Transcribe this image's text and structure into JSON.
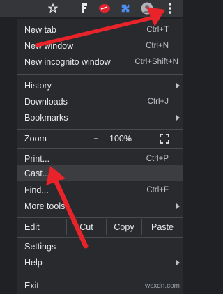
{
  "menu": {
    "new_tab": {
      "label": "New tab",
      "shortcut": "Ctrl+T"
    },
    "new_window": {
      "label": "New window",
      "shortcut": "Ctrl+N"
    },
    "new_incognito": {
      "label": "New incognito window",
      "shortcut": "Ctrl+Shift+N"
    },
    "history": {
      "label": "History"
    },
    "downloads": {
      "label": "Downloads",
      "shortcut": "Ctrl+J"
    },
    "bookmarks": {
      "label": "Bookmarks"
    },
    "zoom": {
      "label": "Zoom",
      "minus": "−",
      "value": "100%",
      "plus": "+"
    },
    "print": {
      "label": "Print...",
      "shortcut": "Ctrl+P"
    },
    "cast": {
      "label": "Cast..."
    },
    "find": {
      "label": "Find...",
      "shortcut": "Ctrl+F"
    },
    "more_tools": {
      "label": "More tools"
    },
    "edit": {
      "label": "Edit",
      "cut": "Cut",
      "copy": "Copy",
      "paste": "Paste"
    },
    "settings": {
      "label": "Settings"
    },
    "help": {
      "label": "Help"
    },
    "exit": {
      "label": "Exit"
    }
  },
  "watermark": "wsxdn.com",
  "colors": {
    "arrow": "#e8232a",
    "menu_bg": "#292a2d",
    "text": "#e8eaed"
  }
}
